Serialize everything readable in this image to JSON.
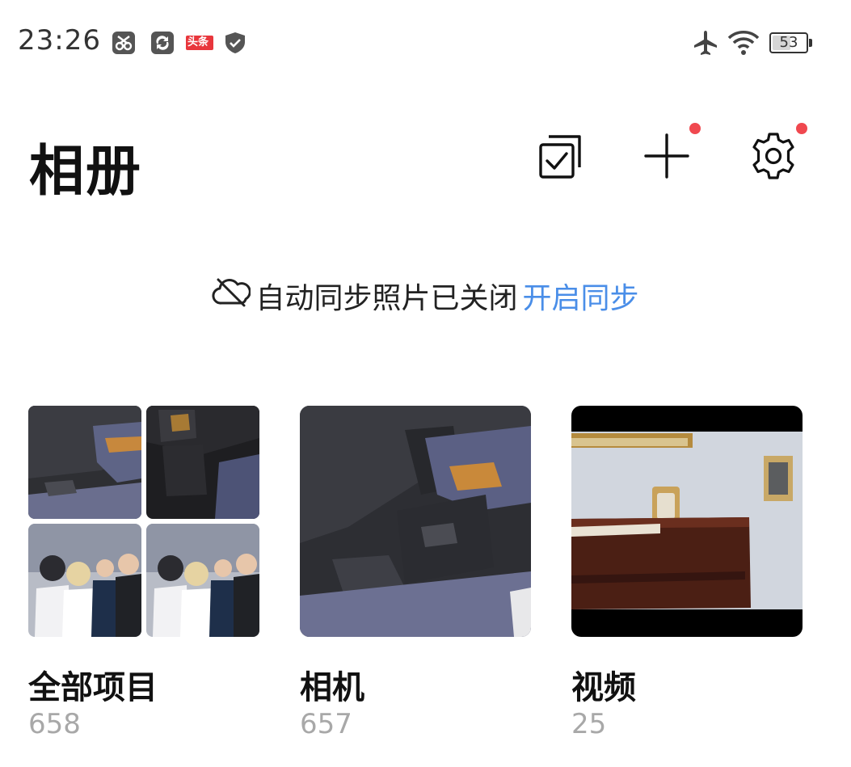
{
  "status_bar": {
    "time": "23:26",
    "toutiao_badge": "头条",
    "battery": "53"
  },
  "header": {
    "title": "相册"
  },
  "sync_notice": {
    "message": "自动同步照片已关闭",
    "action": "开启同步"
  },
  "albums": [
    {
      "name": "全部项目",
      "count": "658"
    },
    {
      "name": "相机",
      "count": "657"
    },
    {
      "name": "视频",
      "count": "25"
    }
  ],
  "icons": {
    "select": "select-multiple-icon",
    "add": "plus-icon",
    "settings": "gear-icon",
    "cloud_off": "cloud-off-icon"
  },
  "colors": {
    "accent": "#4a8ee8",
    "badge": "#f0484f",
    "count": "#a8a8a8"
  }
}
